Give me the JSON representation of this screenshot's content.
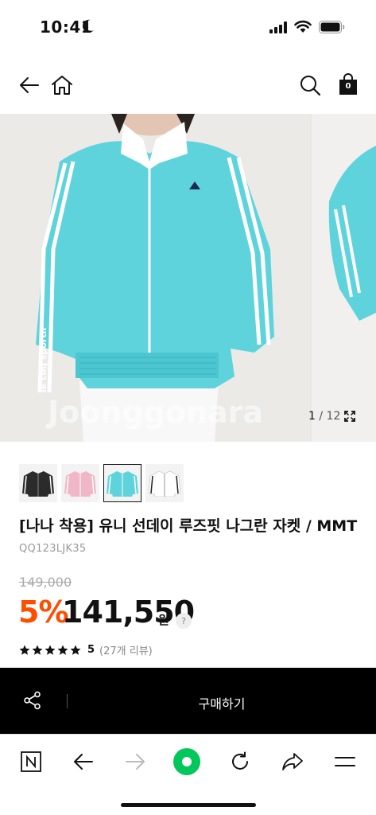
{
  "status_bar": {
    "time": "10:41"
  },
  "header": {
    "cart_count": "0"
  },
  "gallery": {
    "current_page": "1",
    "separator": "/",
    "total_pages": "12",
    "watermark": "Joonggonara",
    "sleeve_text": "le coq sportif"
  },
  "thumbnails": [
    {
      "color": "#2b2b2b",
      "stripe": "#ffffff"
    },
    {
      "color": "#f0b7c8",
      "stripe": "#ffffff"
    },
    {
      "color": "#5fd3dc",
      "stripe": "#ffffff",
      "selected": true
    },
    {
      "color": "#f7f7f7",
      "stripe": "#222222"
    }
  ],
  "product": {
    "title": "[나나 착용] 유니 선데이 루즈핏 나그란 자켓 / MMT",
    "code": "QQ123LJK35",
    "original_price": "149,000",
    "discount": "5%",
    "price": "141,550",
    "currency": "원",
    "help_symbol": "?",
    "rating": "5",
    "review_count": "(27개 리뷰)"
  },
  "buy_bar": {
    "label": "구매하기"
  },
  "colors": {
    "discount": "#ff4d00",
    "jacket": "#5fd3dc",
    "naver_green": "#03c75a"
  }
}
